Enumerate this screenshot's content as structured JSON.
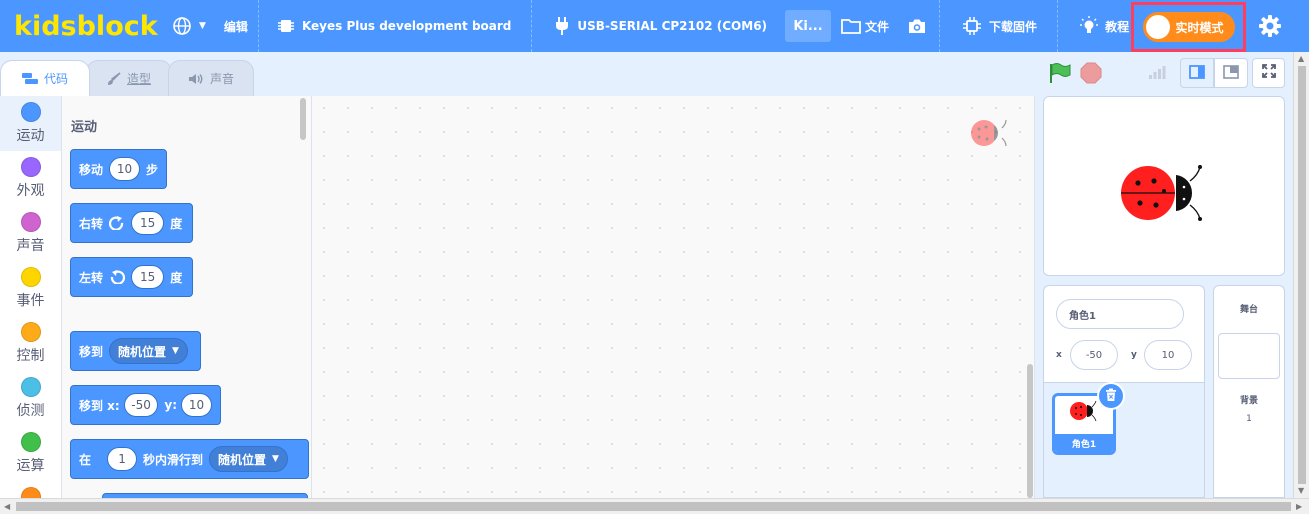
{
  "menubar": {
    "logo": "kidsblock",
    "edit": "编辑",
    "board": "Keyes Plus development board",
    "port": "USB-SERIAL CP2102 (COM6)",
    "project_tab": "Ki...",
    "file": "文件",
    "firmware": "下载固件",
    "tutorial": "教程",
    "realtime_mode": "实时模式"
  },
  "tabs": {
    "code": "代码",
    "costumes": "造型",
    "sounds": "声音"
  },
  "categories": [
    {
      "label": "运动",
      "color": "#4c97ff"
    },
    {
      "label": "外观",
      "color": "#9966ff"
    },
    {
      "label": "声音",
      "color": "#cf63cf"
    },
    {
      "label": "事件",
      "color": "#ffd500"
    },
    {
      "label": "控制",
      "color": "#ffab19"
    },
    {
      "label": "侦测",
      "color": "#4cbfe6"
    },
    {
      "label": "运算",
      "color": "#40bf4a"
    }
  ],
  "palette": {
    "section_title": "运动",
    "move": {
      "label": "移动",
      "value": "10",
      "suffix": "步"
    },
    "turn_right": {
      "label": "右转",
      "value": "15",
      "suffix": "度"
    },
    "turn_left": {
      "label": "左转",
      "value": "15",
      "suffix": "度"
    },
    "goto": {
      "label": "移到",
      "option": "随机位置"
    },
    "goto_xy": {
      "label": "移到 x:",
      "x": "-50",
      "ylabel": "y:",
      "y": "10"
    },
    "glide": {
      "label": "在",
      "value": "1",
      "mid": "秒内滑行到",
      "option": "随机位置"
    }
  },
  "sprite": {
    "name": "角色1",
    "x_label": "x",
    "x": "-50",
    "y_label": "y",
    "y": "10",
    "tile_label": "角色1"
  },
  "stage_pane": {
    "title": "舞台",
    "backdrop_label": "背景",
    "backdrop_count": "1"
  },
  "colors": {
    "primary": "#4c97ff",
    "logo": "#ffe600",
    "realtime": "#ff8c1a",
    "highlight_box": "#ff3d5c"
  }
}
